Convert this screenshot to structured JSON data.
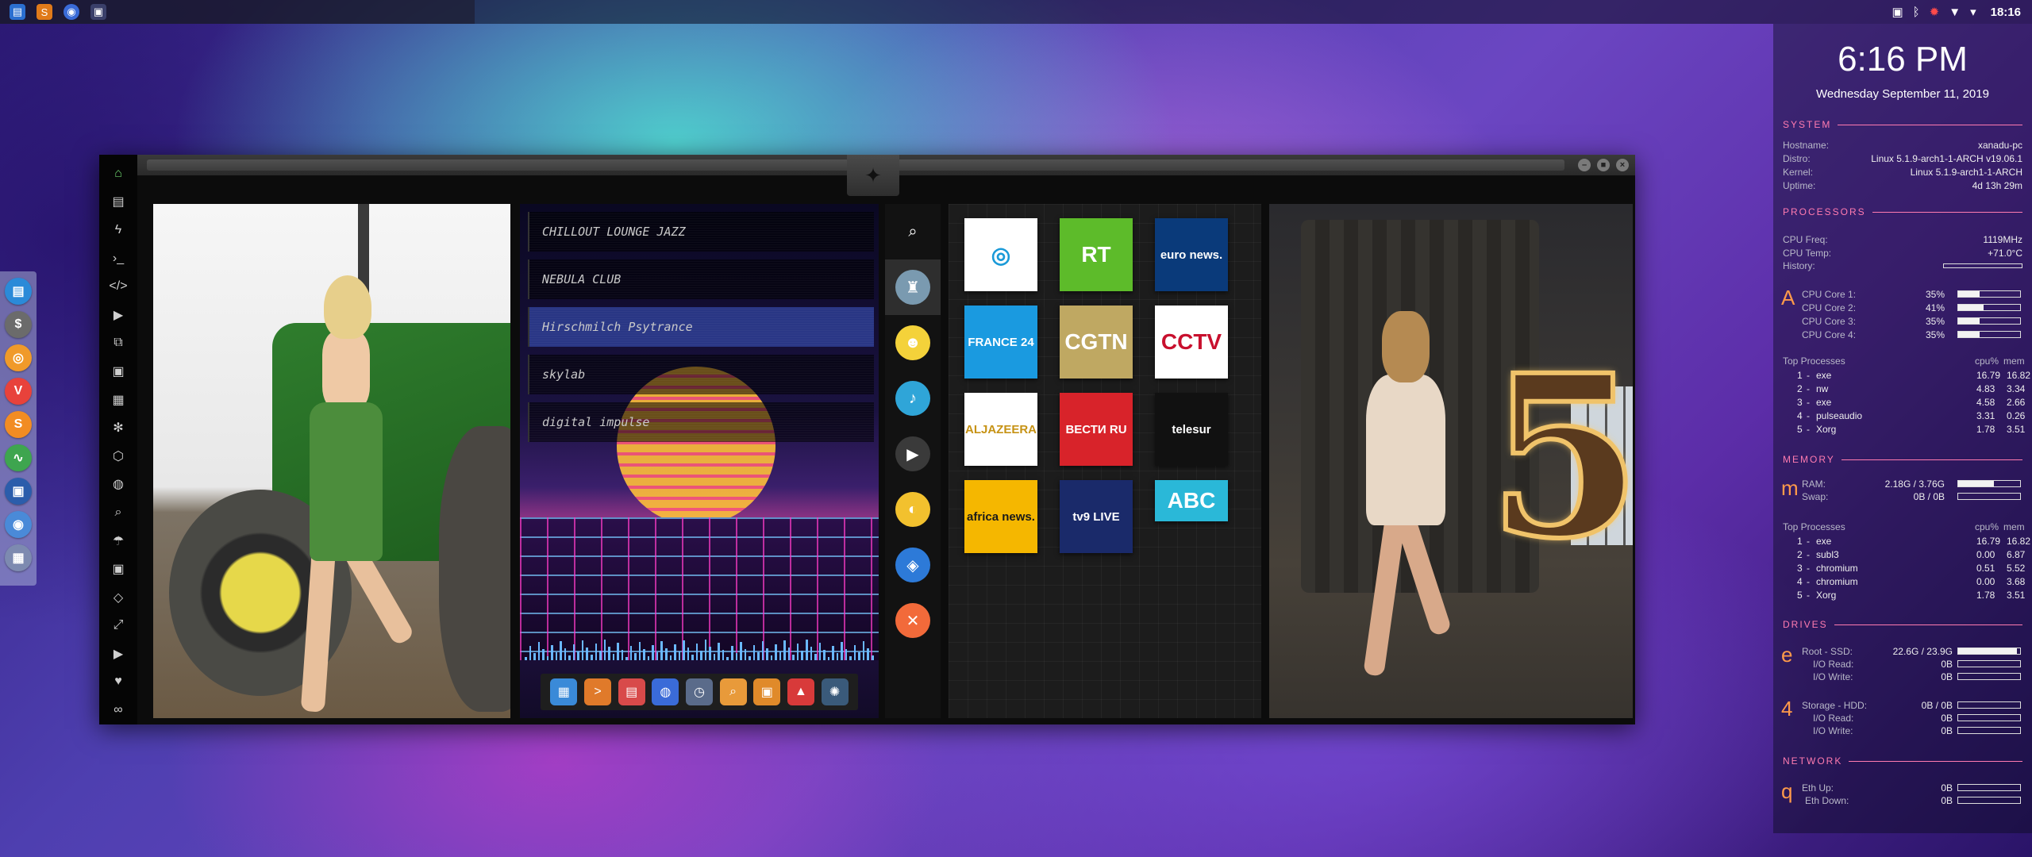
{
  "topbar": {
    "clock": "18:16",
    "launchers": [
      "files-icon",
      "sublime-text-icon",
      "chromium-icon",
      "terminal-icon"
    ],
    "tray_icons": [
      "screenshot-icon",
      "bluetooth-icon",
      "bug-icon",
      "network-icon",
      "dropdown-arrow-icon"
    ]
  },
  "dock": {
    "items": [
      {
        "name": "files",
        "glyph": "▤",
        "color": "#2b8ad8"
      },
      {
        "name": "money",
        "glyph": "$",
        "color": "#6b6b6b"
      },
      {
        "name": "ubuntu",
        "glyph": "◎",
        "color": "#f09a2a"
      },
      {
        "name": "vivaldi",
        "glyph": "V",
        "color": "#e8423b"
      },
      {
        "name": "sublime",
        "glyph": "S",
        "color": "#f28c23"
      },
      {
        "name": "monitor",
        "glyph": "∿",
        "color": "#3ea54f"
      },
      {
        "name": "screen",
        "glyph": "▣",
        "color": "#2b5dab"
      },
      {
        "name": "chromium",
        "glyph": "◉",
        "color": "#4a8ad8"
      },
      {
        "name": "apps",
        "glyph": "▦",
        "color": "#7d8ab0"
      }
    ]
  },
  "window": {
    "side_icons": [
      "home-icon",
      "document-icon",
      "bolt-icon",
      "terminal-icon",
      "code-icon",
      "play-icon",
      "copy-icon",
      "image-icon",
      "news-icon",
      "aperture-icon",
      "hexagon-icon",
      "globe-icon",
      "search-icon",
      "umbrella-icon",
      "contact-icon",
      "brackets-icon",
      "expand-icon",
      "youtube-icon",
      "heart-icon",
      "infinity-icon"
    ],
    "emblem": "✦"
  },
  "music": {
    "stations": [
      {
        "label": "CHILLOUT LOUNGE JAZZ",
        "selected": false
      },
      {
        "label": "NEBULA CLUB",
        "selected": false
      },
      {
        "label": "Hirschmilch Psytrance",
        "selected": true
      },
      {
        "label": "skylab",
        "selected": false
      },
      {
        "label": "digital impulse",
        "selected": false
      }
    ],
    "controls": [
      {
        "name": "calculator",
        "glyph": "▦",
        "color": "#3a8ad8"
      },
      {
        "name": "terminal",
        "glyph": ">",
        "color": "#e07a2a"
      },
      {
        "name": "calendar",
        "glyph": "▤",
        "color": "#d84a4a"
      },
      {
        "name": "globe",
        "glyph": "◍",
        "color": "#3a6bd8"
      },
      {
        "name": "clock",
        "glyph": "◷",
        "color": "#5a6b8a"
      },
      {
        "name": "search",
        "glyph": "⌕",
        "color": "#e89a3a"
      },
      {
        "name": "image-viewer",
        "glyph": "▣",
        "color": "#e08a2a"
      },
      {
        "name": "font",
        "glyph": "▲",
        "color": "#d83a3a"
      },
      {
        "name": "settings",
        "glyph": "✺",
        "color": "#3a5a7a"
      }
    ]
  },
  "categories": [
    {
      "name": "search",
      "glyph": "⌕",
      "color": "transparent",
      "selected": false
    },
    {
      "name": "radio-tower",
      "glyph": "♜",
      "color": "#7a9ab0",
      "selected": true
    },
    {
      "name": "pikachu",
      "glyph": "☻",
      "color": "#f4d23a",
      "selected": false
    },
    {
      "name": "cloud-music",
      "glyph": "♪",
      "color": "#2fa5d8",
      "selected": false
    },
    {
      "name": "movie",
      "glyph": "▶",
      "color": "#3a3a3a",
      "selected": false
    },
    {
      "name": "headphones",
      "glyph": "◐",
      "color": "#f2c12e",
      "selected": false
    },
    {
      "name": "map",
      "glyph": "◈",
      "color": "#2d7ad8",
      "selected": false
    },
    {
      "name": "restaurant",
      "glyph": "✕",
      "color": "#f26a3a",
      "selected": false
    }
  ],
  "channels": [
    {
      "name": "ocean-channel",
      "label": "◎",
      "bg": "#ffffff",
      "fg": "#1a9ad8"
    },
    {
      "name": "rt",
      "label": "RT",
      "bg": "#5dbb2a",
      "fg": "#ffffff"
    },
    {
      "name": "euronews",
      "label": "euro news.",
      "bg": "#0a3a7a",
      "fg": "#ffffff"
    },
    {
      "name": "france24",
      "label": "FRANCE 24",
      "bg": "#1a9ae0",
      "fg": "#ffffff"
    },
    {
      "name": "cgtn",
      "label": "CGTN",
      "bg": "#bfa862",
      "fg": "#ffffff"
    },
    {
      "name": "cctv",
      "label": "CCTV",
      "bg": "#ffffff",
      "fg": "#c8102e"
    },
    {
      "name": "aljazeera",
      "label": "ALJAZEERA",
      "bg": "#ffffff",
      "fg": "#c69214"
    },
    {
      "name": "vesti-ru",
      "label": "ВЕСТИ RU",
      "bg": "#d8232a",
      "fg": "#ffffff"
    },
    {
      "name": "telesur",
      "label": "telesur",
      "bg": "#111111",
      "fg": "#ffffff"
    },
    {
      "name": "africanews",
      "label": "africa news.",
      "bg": "#f5b700",
      "fg": "#1a1a1a"
    },
    {
      "name": "tv9",
      "label": "tv9 LIVE",
      "bg": "#1a2a6a",
      "fg": "#ffffff"
    },
    {
      "name": "abc",
      "label": "ABC",
      "bg": "#2ab8d8",
      "fg": "#ffffff"
    }
  ],
  "conky": {
    "time": "6:16 PM",
    "date": "Wednesday September 11, 2019",
    "system": {
      "title": "SYSTEM",
      "rows": [
        {
          "label": "Hostname:",
          "value": "xanadu-pc"
        },
        {
          "label": "Distro:",
          "value": "Linux 5.1.9-arch1-1-ARCH v19.06.1"
        },
        {
          "label": "Kernel:",
          "value": "Linux 5.1.9-arch1-1-ARCH"
        },
        {
          "label": "Uptime:",
          "value": "4d 13h 29m"
        }
      ]
    },
    "processors": {
      "title": "PROCESSORS",
      "freq_label": "CPU Freq:",
      "freq": "1119MHz",
      "temp_label": "CPU Temp:",
      "temp": "+71.0°C",
      "history_label": "History:",
      "letter": "A",
      "cores": [
        {
          "label": "CPU Core 1:",
          "value": "35%",
          "pct": 0.35
        },
        {
          "label": "CPU Core 2:",
          "value": "41%",
          "pct": 0.41
        },
        {
          "label": "CPU Core 3:",
          "value": "35%",
          "pct": 0.35
        },
        {
          "label": "CPU Core 4:",
          "value": "35%",
          "pct": 0.35
        }
      ],
      "top_title": "Top Processes",
      "col_cpu": "cpu%",
      "col_mem": "mem",
      "top": [
        {
          "rank": "1",
          "name": "exe",
          "cpu": "16.79",
          "mem": "16.82"
        },
        {
          "rank": "2",
          "name": "nw",
          "cpu": "4.83",
          "mem": "3.34"
        },
        {
          "rank": "3",
          "name": "exe",
          "cpu": "4.58",
          "mem": "2.66"
        },
        {
          "rank": "4",
          "name": "pulseaudio",
          "cpu": "3.31",
          "mem": "0.26"
        },
        {
          "rank": "5",
          "name": "Xorg",
          "cpu": "1.78",
          "mem": "3.51"
        }
      ]
    },
    "memory": {
      "title": "MEMORY",
      "letter": "m",
      "ram_label": "RAM:",
      "ram": "2.18G / 3.76G",
      "ram_pct": 0.58,
      "swap_label": "Swap:",
      "swap": "0B / 0B",
      "swap_pct": 0,
      "top_title": "Top Processes",
      "col_cpu": "cpu%",
      "col_mem": "mem",
      "top": [
        {
          "rank": "1",
          "name": "exe",
          "cpu": "16.79",
          "mem": "16.82"
        },
        {
          "rank": "2",
          "name": "subl3",
          "cpu": "0.00",
          "mem": "6.87"
        },
        {
          "rank": "3",
          "name": "chromium",
          "cpu": "0.51",
          "mem": "5.52"
        },
        {
          "rank": "4",
          "name": "chromium",
          "cpu": "0.00",
          "mem": "3.68"
        },
        {
          "rank": "5",
          "name": "Xorg",
          "cpu": "1.78",
          "mem": "3.51"
        }
      ]
    },
    "drives": {
      "title": "DRIVES",
      "root": {
        "letter": "e",
        "label": "Root - SSD:",
        "value": "22.6G / 23.9G",
        "pct": 0.95,
        "read_label": "I/O Read:",
        "read": "0B",
        "write_label": "I/O Write:",
        "write": "0B"
      },
      "storage": {
        "letter": "4",
        "label": "Storage - HDD:",
        "value": "0B / 0B",
        "pct": 0,
        "read_label": "I/O Read:",
        "read": "0B",
        "write_label": "I/O Write:",
        "write": "0B"
      }
    },
    "network": {
      "title": "NETWORK",
      "letter": "q",
      "up_label": "Eth Up:",
      "up": "0B",
      "down_label": "Eth Down:",
      "down": "0B"
    }
  }
}
